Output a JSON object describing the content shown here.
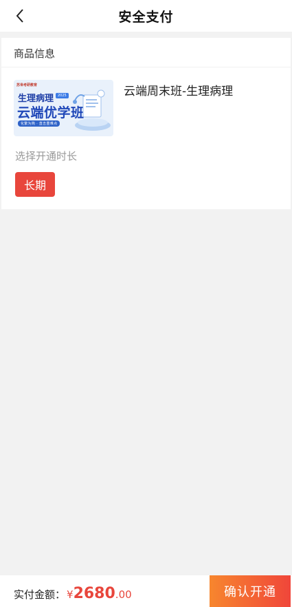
{
  "header": {
    "title": "安全支付",
    "back_icon": "chevron-left-icon"
  },
  "product_section": {
    "label": "商品信息",
    "thumbnail": {
      "brand": "苏世考研教育",
      "title_line1": "生理病理",
      "badge": "2025",
      "title_line2": "云端优学班",
      "tag": "化繁为简 · 直击重难点"
    },
    "product_name": "云端周末班-生理病理"
  },
  "duration": {
    "label": "选择开通时长",
    "selected_option": "长期"
  },
  "footer": {
    "amount_label": "实付金额：",
    "currency_symbol": "¥",
    "amount_integer": "2680",
    "amount_decimal": ".00",
    "confirm_label": "确认开通"
  },
  "colors": {
    "accent_red": "#e8463c",
    "gradient_start": "#f7862e",
    "gradient_end": "#f0463a",
    "background": "#f2f2f2"
  }
}
